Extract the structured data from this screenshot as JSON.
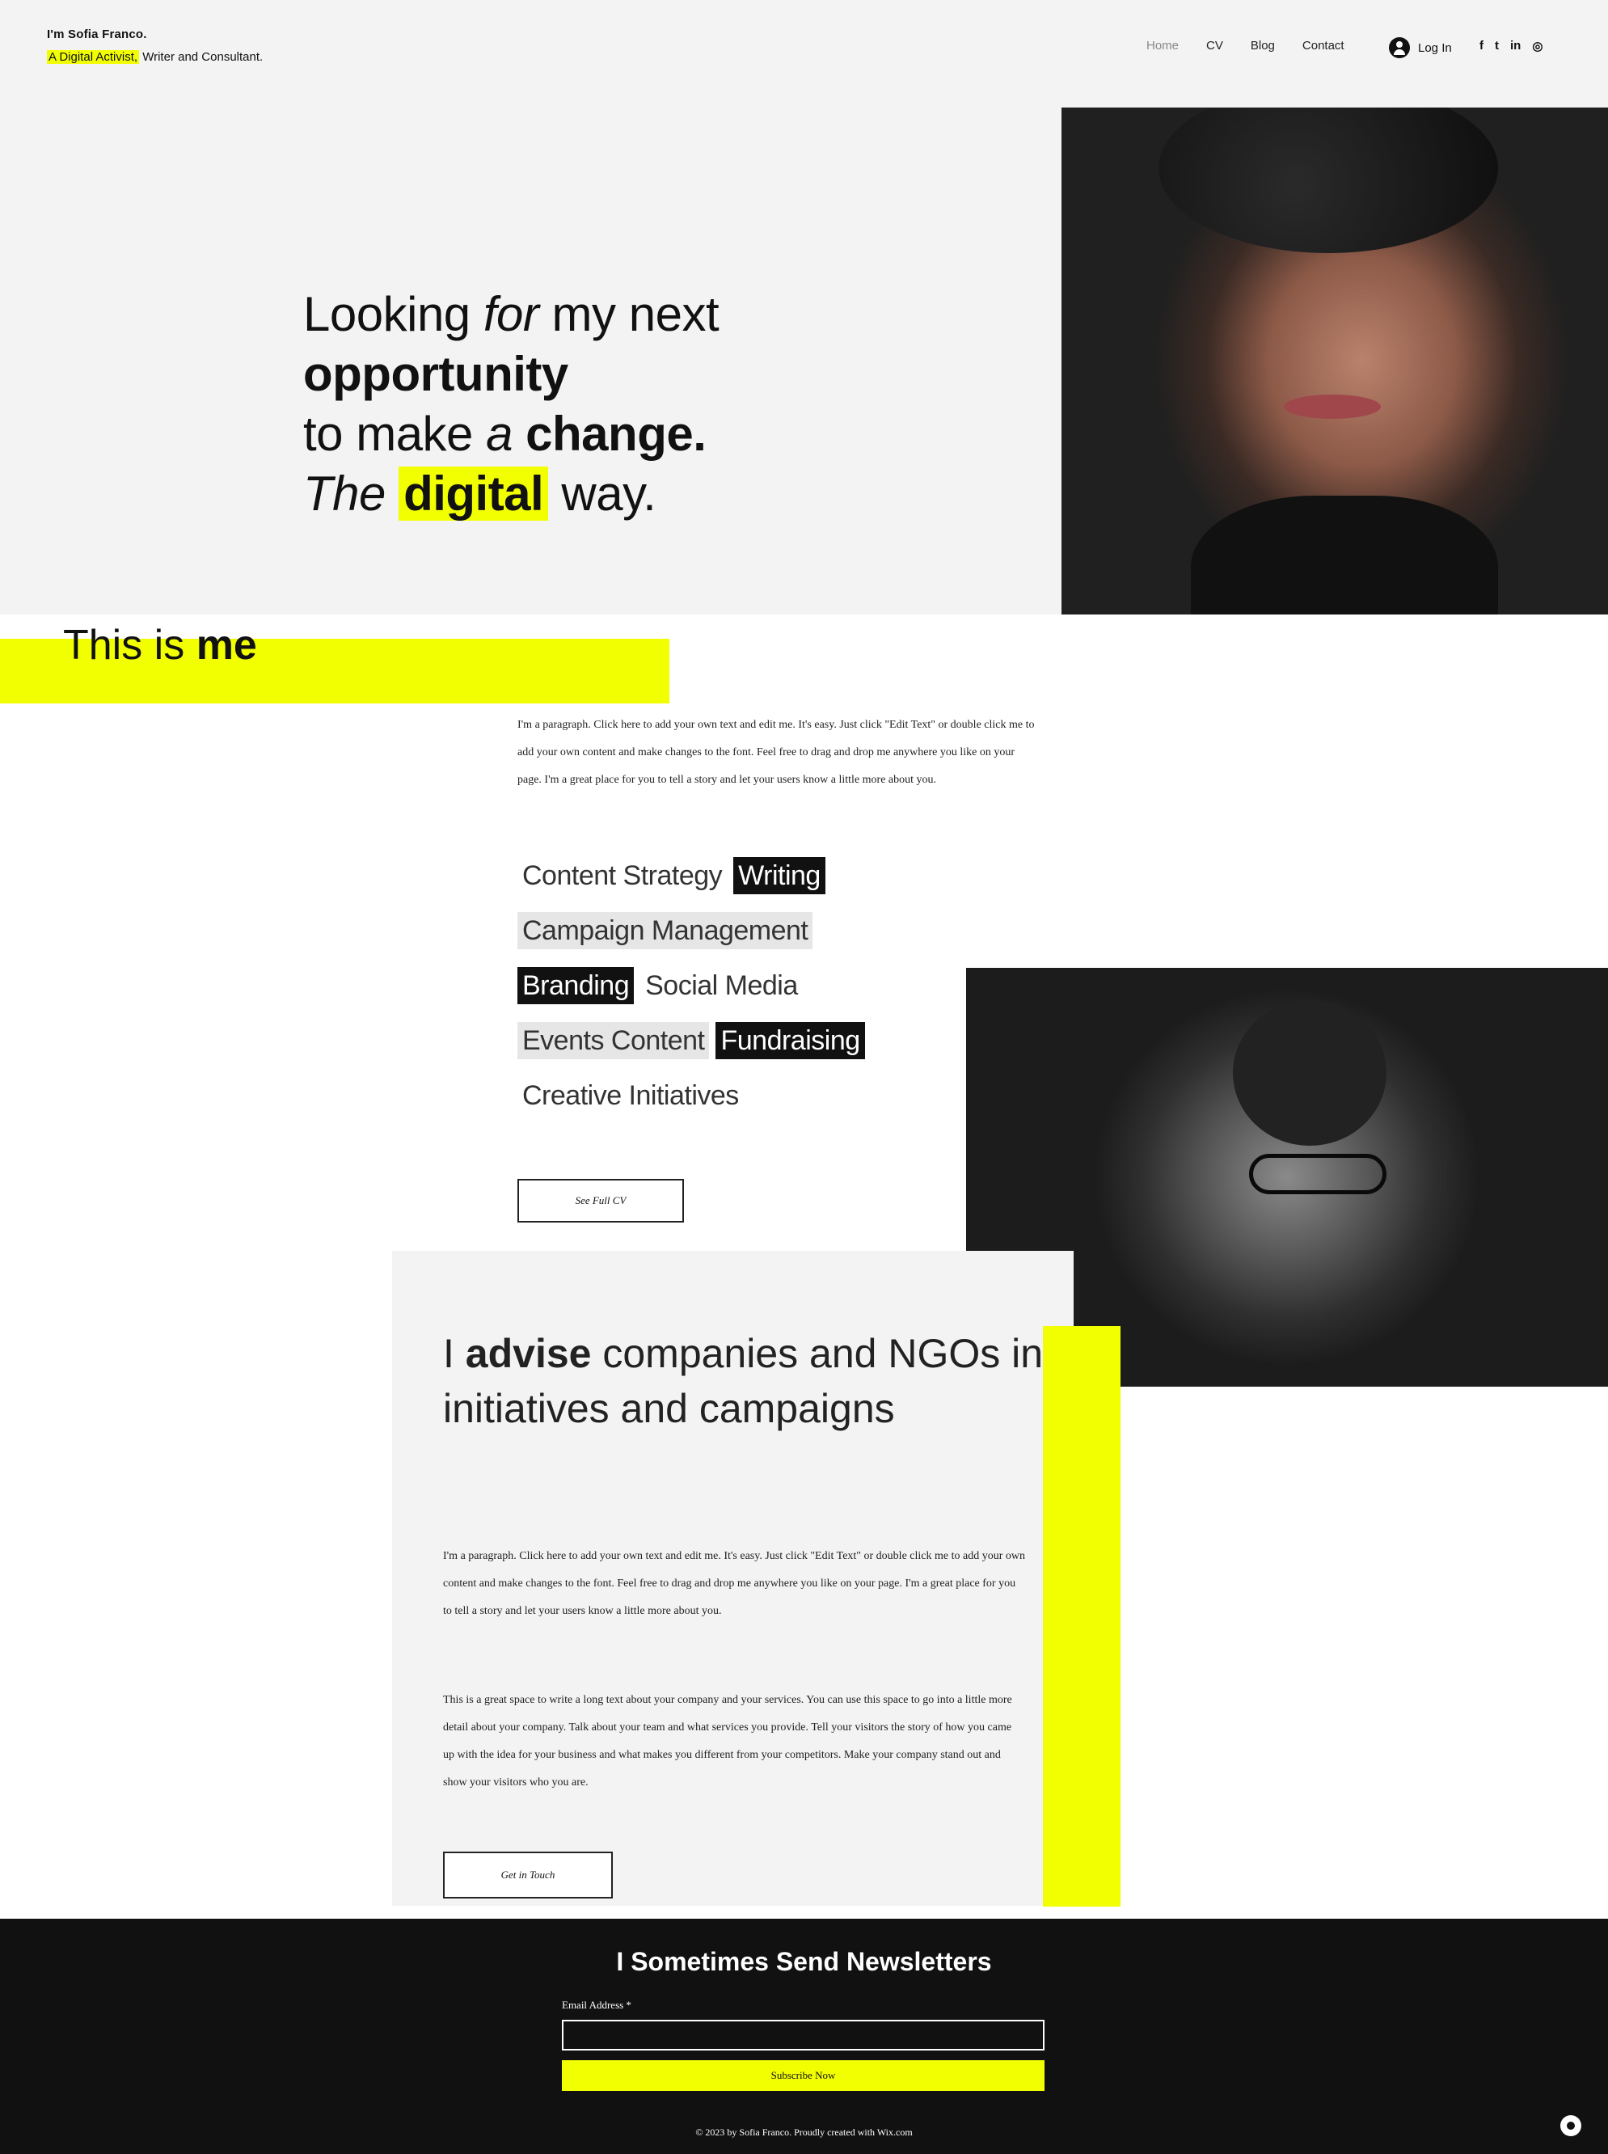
{
  "header": {
    "site_name": "I'm Sofia Franco.",
    "tagline_highlight": "A Digital Activist,",
    "tagline_rest": " Writer and Consultant.",
    "nav": [
      "Home",
      "CV",
      "Blog",
      "Contact"
    ],
    "login_label": "Log In",
    "social": [
      "f",
      "t",
      "in",
      "◎"
    ]
  },
  "hero": {
    "line1_a": "Looking ",
    "line1_b": "for",
    "line1_c": " my next",
    "line2": "opportunity",
    "line3_a": "to make ",
    "line3_b": "a",
    "line3_c": " change.",
    "line4_a": "The",
    "line4_b": "digital",
    "line4_c": " way."
  },
  "about": {
    "title_a": "This is ",
    "title_b": "me",
    "paragraph": "I'm a paragraph. Click here to add your own text and edit me. It's easy. Just click \"Edit Text\" or double click me to add your own content and make changes to the font. Feel free to drag and drop me anywhere you like on your page. I'm a great place for you to tell a story and let your users know a little more about you.",
    "skills": {
      "content_strategy": "Content Strategy",
      "writing": "Writing",
      "campaign_management": "Campaign Management",
      "branding": "Branding",
      "social_media": "Social Media",
      "events_content": "Events Content",
      "fundraising": "Fundraising",
      "creative_initiatives": "Creative Initiatives"
    },
    "cv_button": "See Full CV"
  },
  "advise": {
    "title_a": "I ",
    "title_b": "advise",
    "title_c": " companies and NGOs in initiatives and campaigns",
    "paragraph1": "I'm a paragraph. Click here to add your own text and edit me. It's easy. Just click \"Edit Text\" or double click me to add your own content and make changes to the font. Feel free to drag and drop me anywhere you like on your page. I'm a great place for you to tell a story and let your users know a little more about you.",
    "paragraph2": "This is a great space to write a long text about your company and your services. You can use this space to go into a little more detail about your company. Talk about your team and what services you provide. Tell your visitors the story of how you came up with the idea for your business and what makes you different from your competitors. Make your company stand out and show your visitors who you are.",
    "button": "Get in Touch"
  },
  "footer": {
    "newsletter_title": "I Sometimes Send Newsletters",
    "email_label": "Email Address *",
    "email_value": "",
    "subscribe_label": "Subscribe Now",
    "copyright": "© 2023 by Sofia Franco. Proudly created with Wix.com"
  },
  "colors": {
    "accent": "#f2ff00",
    "dark": "#111111",
    "light_bg": "#f3f3f3"
  }
}
